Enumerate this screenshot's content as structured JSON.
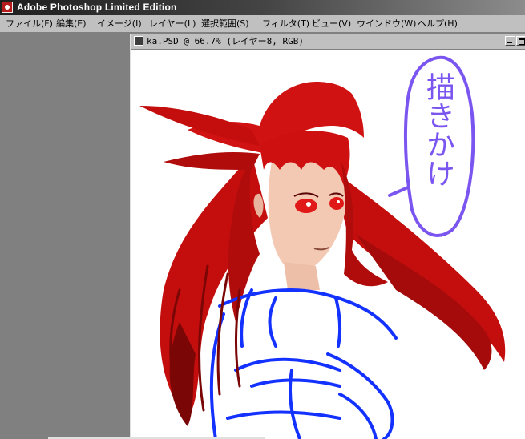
{
  "app": {
    "title": "Adobe Photoshop Limited Edition"
  },
  "menu": [
    {
      "label": "ファイル(F)"
    },
    {
      "label": "編集(E)"
    },
    {
      "label": "イメージ(I)"
    },
    {
      "label": "レイヤー(L)"
    },
    {
      "label": "選択範囲(S)"
    },
    {
      "label": "フィルタ(T)"
    },
    {
      "label": "ビュー(V)"
    },
    {
      "label": "ウインドウ(W)"
    },
    {
      "label": "ヘルプ(H)"
    }
  ],
  "document": {
    "title": "ka.PSD @ 66.7% (レイヤー8, RGB)",
    "zoom": "66.7%",
    "layer": "レイヤー8",
    "mode": "RGB"
  },
  "artwork": {
    "speech_text": "描きかけ",
    "colors": {
      "hair": "#c40d0d",
      "hair_dark": "#7a0606",
      "skin": "#f3c9b4",
      "eyes": "#e01818",
      "sketch_blue": "#1432ff",
      "bubble_purple": "#7b55f0"
    }
  },
  "icons": {
    "app_icon": "photoshop-app-icon",
    "doc_icon": "document-icon",
    "minimize": "minimize-icon",
    "maximize": "maximize-icon"
  }
}
